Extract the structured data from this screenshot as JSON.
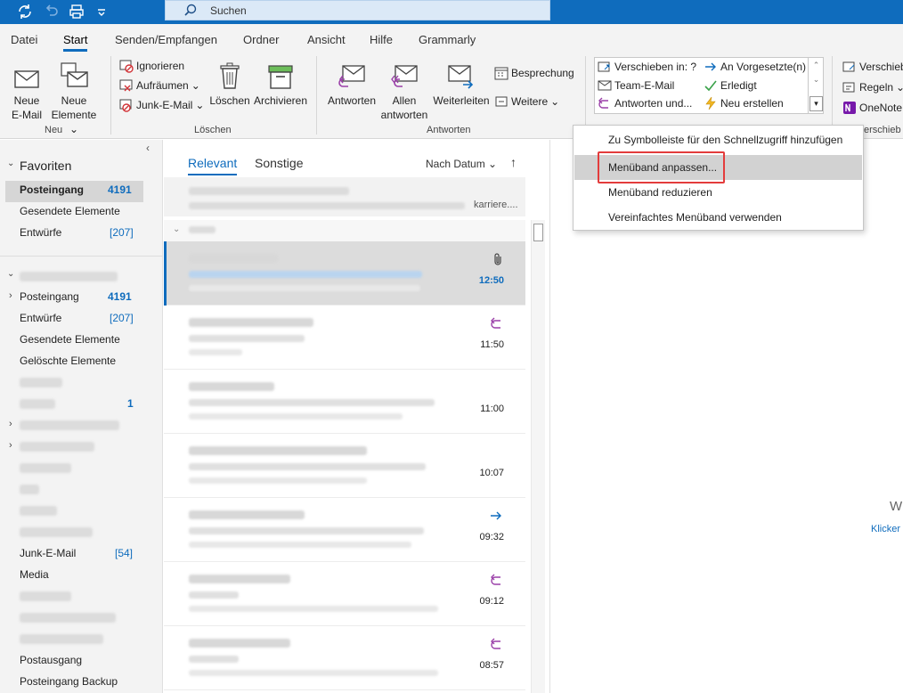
{
  "quick_access": {
    "search_placeholder": "Suchen"
  },
  "menu_tabs": [
    "Datei",
    "Start",
    "Senden/Empfangen",
    "Ordner",
    "Ansicht",
    "Hilfe",
    "Grammarly"
  ],
  "ribbon": {
    "neu": {
      "email_l1": "Neue",
      "email_l2": "E-Mail",
      "elem_l1": "Neue",
      "elem_l2": "Elemente",
      "group": "Neu"
    },
    "loeschen": {
      "ignorieren": "Ignorieren",
      "aufraeumen": "Aufräumen",
      "junk": "Junk-E-Mail",
      "loeschen": "Löschen",
      "archivieren": "Archivieren",
      "group": "Löschen"
    },
    "antworten": {
      "antworten": "Antworten",
      "allen_l1": "Allen",
      "allen_l2": "antworten",
      "weiterleiten": "Weiterleiten",
      "besprechung": "Besprechung",
      "weitere": "Weitere",
      "group": "Antworten"
    },
    "quicksteps": {
      "verschieben": "Verschieben in: ?",
      "team": "Team-E-Mail",
      "antworten_und": "Antworten und...",
      "vorgesetzte": "An Vorgesetzte(n)",
      "erledigt": "Erledigt",
      "neu_erstellen": "Neu erstellen"
    },
    "verschieben": {
      "verschieben": "Verschieb",
      "regeln": "Regeln",
      "onenote": "OneNote",
      "group": "erschieb"
    }
  },
  "nav": {
    "favoriten": "Favoriten",
    "fav_posteingang": "Posteingang",
    "fav_posteingang_count": "4191",
    "fav_gesendet": "Gesendete Elemente",
    "fav_entwuerfe": "Entwürfe",
    "fav_entwuerfe_count": "[207]",
    "acc_posteingang": "Posteingang",
    "acc_posteingang_count": "4191",
    "acc_entwuerfe": "Entwürfe",
    "acc_entwuerfe_count": "[207]",
    "acc_gesendet": "Gesendete Elemente",
    "acc_geloescht": "Gelöschte Elemente",
    "blurred_count": "1",
    "junk": "Junk-E-Mail",
    "junk_count": "[54]",
    "media": "Media",
    "postausgang": "Postausgang",
    "backup": "Posteingang Backup"
  },
  "list": {
    "tab_relevant": "Relevant",
    "tab_sonstige": "Sonstige",
    "sort": "Nach Datum",
    "partial_text": "karriere....",
    "times": [
      "12:50",
      "11:50",
      "11:00",
      "10:07",
      "09:32",
      "09:12",
      "08:57"
    ]
  },
  "reading": {
    "partial_w": "W",
    "partial_link": "Klicker"
  },
  "context_menu": {
    "items": [
      "Zu Symbolleiste für den Schnellzugriff hinzufügen",
      "Menüband anpassen...",
      "Menüband reduzieren",
      "Vereinfachtes Menüband verwenden"
    ]
  },
  "colors": {
    "accent": "#0f6cbd",
    "highlight": "#e33c3c",
    "reply": "#9a3fa8"
  }
}
